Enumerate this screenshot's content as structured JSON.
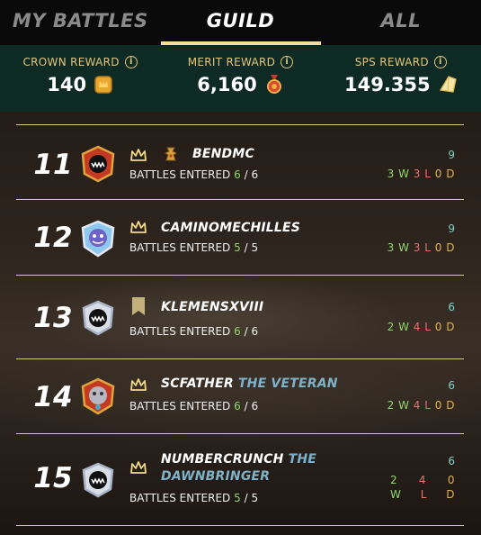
{
  "tabs": [
    {
      "label": "MY BATTLES",
      "active": false
    },
    {
      "label": "GUILD",
      "active": true
    },
    {
      "label": "ALL",
      "active": false
    }
  ],
  "rewards": [
    {
      "label": "CROWN REWARD",
      "value": "140",
      "icon": "crown-token-icon"
    },
    {
      "label": "MERIT REWARD",
      "value": "6,160",
      "icon": "merit-medal-icon"
    },
    {
      "label": "SPS REWARD",
      "value": "149.355",
      "icon": "sps-crystal-icon"
    }
  ],
  "info_glyph": "i",
  "rows": [
    {
      "rank": "11",
      "name": "BENDMC",
      "title": "",
      "badge": "crown-icon",
      "extra_badge": "tower-icon",
      "entered_label": "BATTLES ENTERED",
      "entered": "6",
      "of": "6",
      "total": "9",
      "w": "3",
      "l": "3",
      "d": "0"
    },
    {
      "rank": "12",
      "name": "CAMINOMECHILLES",
      "title": "",
      "badge": "crown-icon",
      "entered_label": "BATTLES ENTERED",
      "entered": "5",
      "of": "5",
      "total": "9",
      "w": "3",
      "l": "3",
      "d": "0"
    },
    {
      "rank": "13",
      "name": "KLEMENSXVIII",
      "title": "",
      "badge": "banner-icon",
      "entered_label": "BATTLES ENTERED",
      "entered": "6",
      "of": "6",
      "total": "6",
      "w": "2",
      "l": "4",
      "d": "0"
    },
    {
      "rank": "14",
      "name": "SCFATHER",
      "title": "THE VETERAN",
      "badge": "crown-icon",
      "entered_label": "BATTLES ENTERED",
      "entered": "6",
      "of": "6",
      "total": "6",
      "w": "2",
      "l": "4",
      "d": "0"
    },
    {
      "rank": "15",
      "name": "NUMBERCRUNCH",
      "title": "THE DAWNBRINGER",
      "badge": "crown-icon",
      "entered_label": "BATTLES ENTERED",
      "entered": "5",
      "of": "5",
      "total": "6",
      "w": "2",
      "l": "4",
      "d": "0"
    }
  ],
  "wld_letters": {
    "w": "W",
    "l": "L",
    "d": "D"
  },
  "colors": {
    "accent": "#f3df9a",
    "gold": "#e3c47a",
    "win": "#8fd66a",
    "loss": "#e86f6f",
    "draw": "#e6b04a",
    "title": "#7fb2c9"
  }
}
